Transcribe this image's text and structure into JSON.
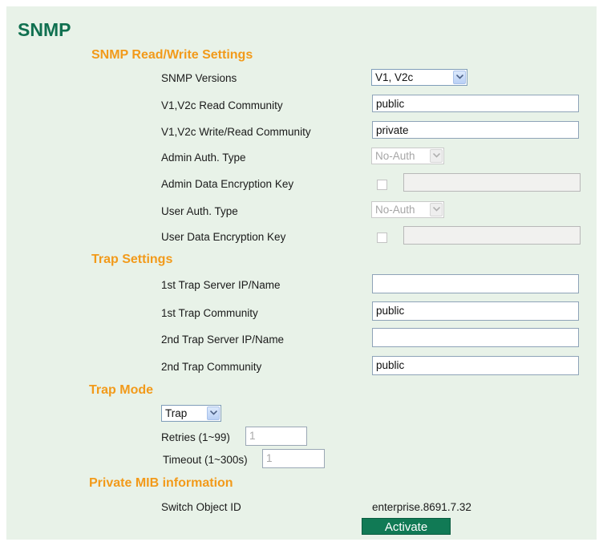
{
  "page": {
    "title": "SNMP"
  },
  "read_write": {
    "heading": "SNMP Read/Write Settings",
    "snmp_versions_label": "SNMP Versions",
    "snmp_versions_value": "V1, V2c",
    "read_community_label": "V1,V2c Read Community",
    "read_community_value": "public",
    "write_community_label": "V1,V2c Write/Read Community",
    "write_community_value": "private",
    "admin_auth_label": "Admin Auth. Type",
    "admin_auth_value": "No-Auth",
    "admin_key_label": "Admin Data Encryption Key",
    "user_auth_label": "User Auth. Type",
    "user_auth_value": "No-Auth",
    "user_key_label": "User Data Encryption Key"
  },
  "trap_settings": {
    "heading": "Trap Settings",
    "trap1_server_label": "1st Trap Server IP/Name",
    "trap1_server_value": "",
    "trap1_community_label": "1st Trap Community",
    "trap1_community_value": "public",
    "trap2_server_label": "2nd Trap Server IP/Name",
    "trap2_server_value": "",
    "trap2_community_label": "2nd Trap Community",
    "trap2_community_value": "public"
  },
  "trap_mode": {
    "heading": "Trap Mode",
    "mode_value": "Trap",
    "retries_label": "Retries (1~99)",
    "retries_value": "1",
    "timeout_label": "Timeout (1~300s)",
    "timeout_value": "1"
  },
  "mib": {
    "heading": "Private MIB information",
    "object_id_label": "Switch Object ID",
    "object_id_value": "enterprise.8691.7.32"
  },
  "actions": {
    "activate_label": "Activate"
  }
}
